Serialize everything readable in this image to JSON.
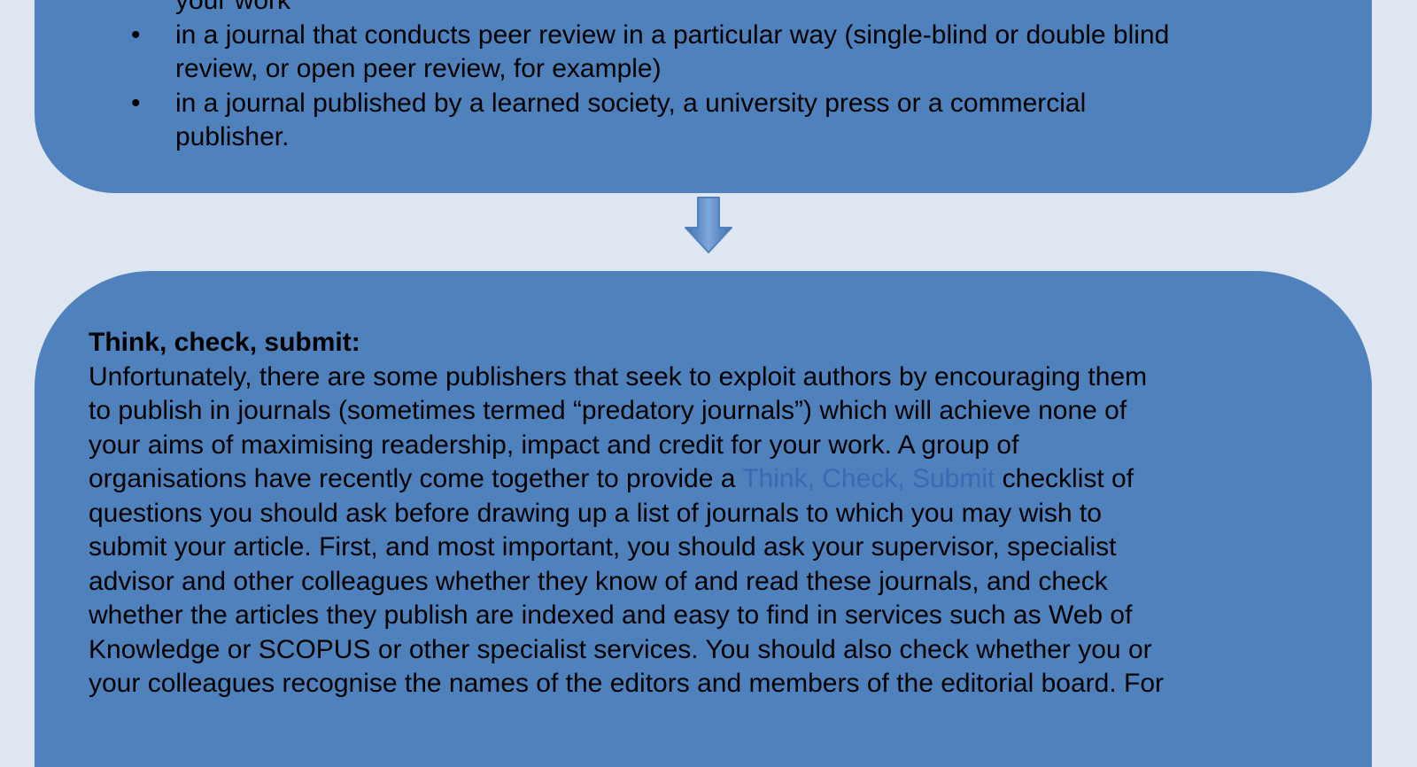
{
  "top_box": {
    "cut_line": "your work",
    "items": [
      {
        "bullet": "•",
        "lines": [
          "in a journal that  conducts peer review in a particular way (single-blind or double blind",
          "review, or open peer review, for example)"
        ]
      },
      {
        "bullet": "•",
        "lines": [
          "in a journal published by a learned society, a university press or a commercial",
          "publisher."
        ]
      }
    ]
  },
  "bottom_box": {
    "heading": "Think, check, submit:",
    "paragraph_lines": [
      "Unfortunately, there are some publishers that seek to exploit authors by encouraging them",
      "to publish in journals (sometimes termed “predatory journals”) which will achieve none of",
      "your aims of maximising readership, impact and credit for your work. A group of"
    ],
    "link_line": {
      "before": "organisations have recently come together to provide a ",
      "link_text": "Think, Check, Submit",
      "after": " checklist of"
    },
    "paragraph_lines_2": [
      "questions you should ask before drawing up a list of journals to which you may wish to",
      "submit your article. First, and most important, you should ask your supervisor, specialist",
      "advisor and other colleagues whether they know of and read these journals, and check",
      "whether the articles they publish are indexed and easy to find in services such as Web of",
      "Knowledge or SCOPUS or other specialist services. You should also check whether you or",
      "your colleagues recognise the names of the editors and members of the editorial board. For"
    ]
  },
  "colors": {
    "background": "#dde6f1",
    "box_fill": "#4f81bd",
    "text": "#ffffff",
    "link": "#3a69b3",
    "arrow": "#4f81bd"
  }
}
